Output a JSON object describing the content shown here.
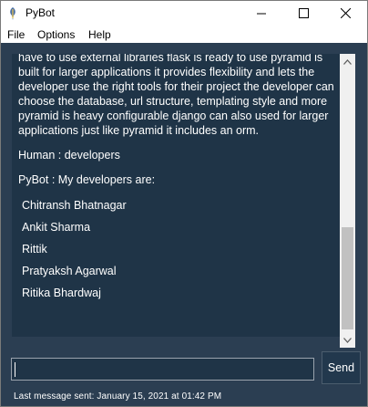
{
  "window": {
    "title": "PyBot",
    "app_icon": "python-feather-icon"
  },
  "menu": [
    "File",
    "Options",
    "Help"
  ],
  "chat": {
    "top_paragraph": "have to use external libraries flask is ready to use pyramid is built for larger applications it provides flexibility and lets the developer use the right tools for their project the developer can choose the database, url structure, templating style and more pyramid is heavy configurable django can also used for larger applications just like pyramid it includes an orm.",
    "human_line": "Human : developers",
    "bot_line": "PyBot : My developers are:",
    "developers": [
      "Chitransh Bhatnagar",
      "Ankit Sharma",
      "Rittik",
      "Pratyaksh Agarwal",
      "Ritika Bhardwaj"
    ]
  },
  "input": {
    "value": ""
  },
  "send_label": "Send",
  "status": "Last message sent: January 15, 2021 at 01:42 PM",
  "colors": {
    "panel_bg": "#2b3e52",
    "chat_bg": "#1f3447",
    "text": "#ffffff"
  }
}
